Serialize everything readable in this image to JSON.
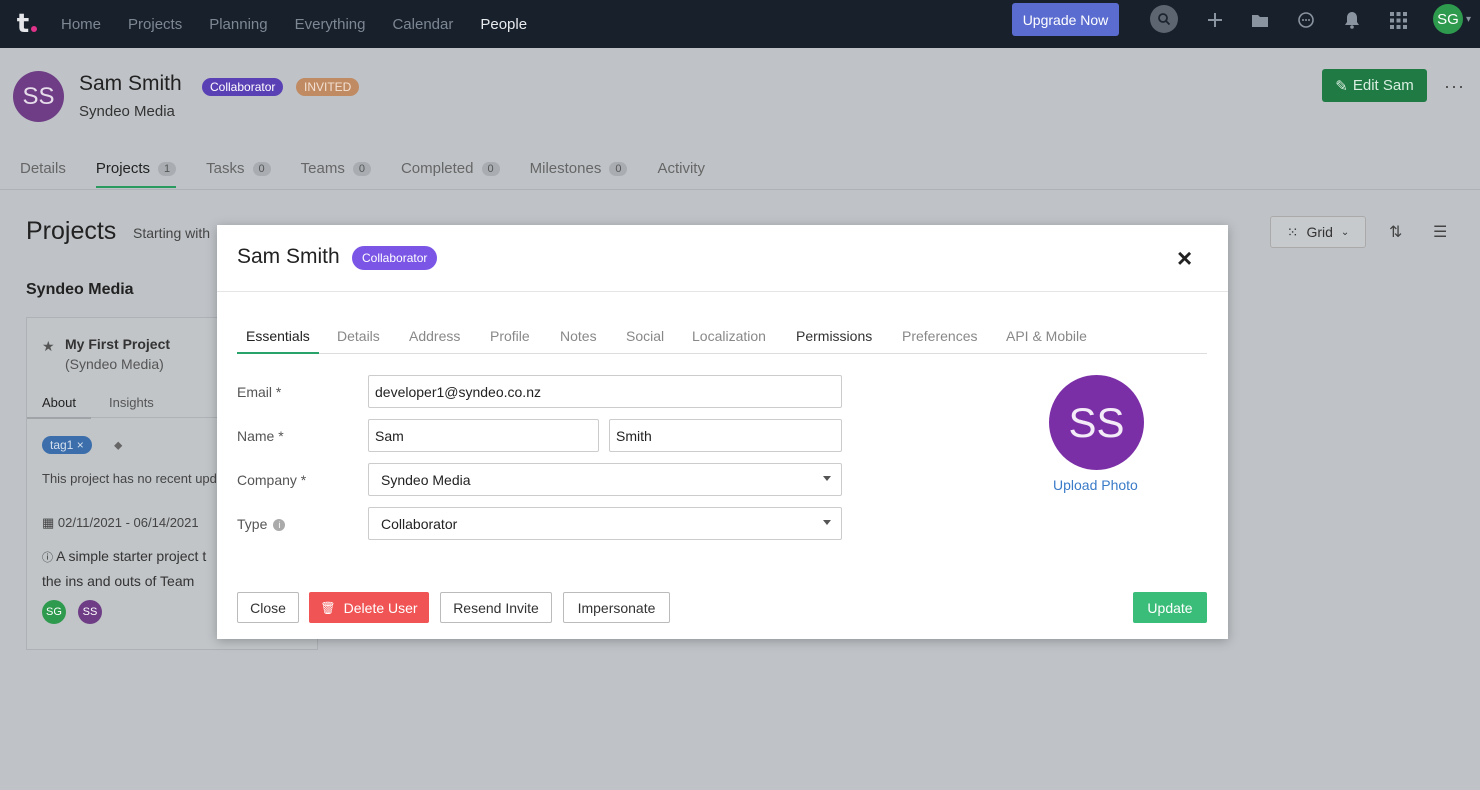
{
  "nav": {
    "logo": "t",
    "links": [
      "Home",
      "Projects",
      "Planning",
      "Everything",
      "Calendar",
      "People"
    ],
    "active": "People",
    "upgrade_label": "Upgrade Now",
    "avatar_initials": "SG"
  },
  "header": {
    "avatar_initials": "SS",
    "name": "Sam Smith",
    "badge_type": "Collaborator",
    "badge_status": "INVITED",
    "company": "Syndeo Media",
    "edit_label": "Edit Sam",
    "more_label": "···"
  },
  "page_tabs": [
    {
      "label": "Details",
      "count": null
    },
    {
      "label": "Projects",
      "count": "1"
    },
    {
      "label": "Tasks",
      "count": "0"
    },
    {
      "label": "Teams",
      "count": "0"
    },
    {
      "label": "Completed",
      "count": "0"
    },
    {
      "label": "Milestones",
      "count": "0"
    },
    {
      "label": "Activity",
      "count": null
    }
  ],
  "projects": {
    "title": "Projects",
    "subtitle": "Starting with",
    "view_label": "Grid",
    "group_title": "Syndeo Media",
    "card": {
      "title": "My First Project",
      "subtitle": "(Syndeo Media)",
      "tabs": [
        "About",
        "Insights"
      ],
      "tag": "tag1",
      "text": "This project has no recent upd",
      "dates": "02/11/2021 - 06/14/2021",
      "desc_line1": "A simple starter project t",
      "desc_line2": "the ins and outs of Team",
      "avatars": [
        "SG",
        "SS"
      ]
    }
  },
  "modal": {
    "title": "Sam Smith",
    "badge": "Collaborator",
    "close_label": "×",
    "tabs": [
      "Essentials",
      "Details",
      "Address",
      "Profile",
      "Notes",
      "Social",
      "Localization",
      "Permissions",
      "Preferences",
      "API & Mobile"
    ],
    "active_tab": "Essentials",
    "fields": {
      "email_label": "Email *",
      "email_value": "developer1@syndeo.co.nz",
      "name_label": "Name *",
      "first_name": "Sam",
      "last_name": "Smith",
      "company_label": "Company *",
      "company_value": "Syndeo Media",
      "type_label": "Type",
      "type_value": "Collaborator"
    },
    "avatar_initials": "SS",
    "upload_label": "Upload Photo",
    "buttons": {
      "close": "Close",
      "delete": "Delete User",
      "resend": "Resend Invite",
      "impersonate": "Impersonate",
      "update": "Update"
    }
  },
  "colors": {
    "nav_bg": "#17202b",
    "accent_green": "#3bbd7a",
    "delete_red": "#f05454",
    "collab_purple": "#7a55e6",
    "avatar_purple": "#7b2fa7"
  }
}
